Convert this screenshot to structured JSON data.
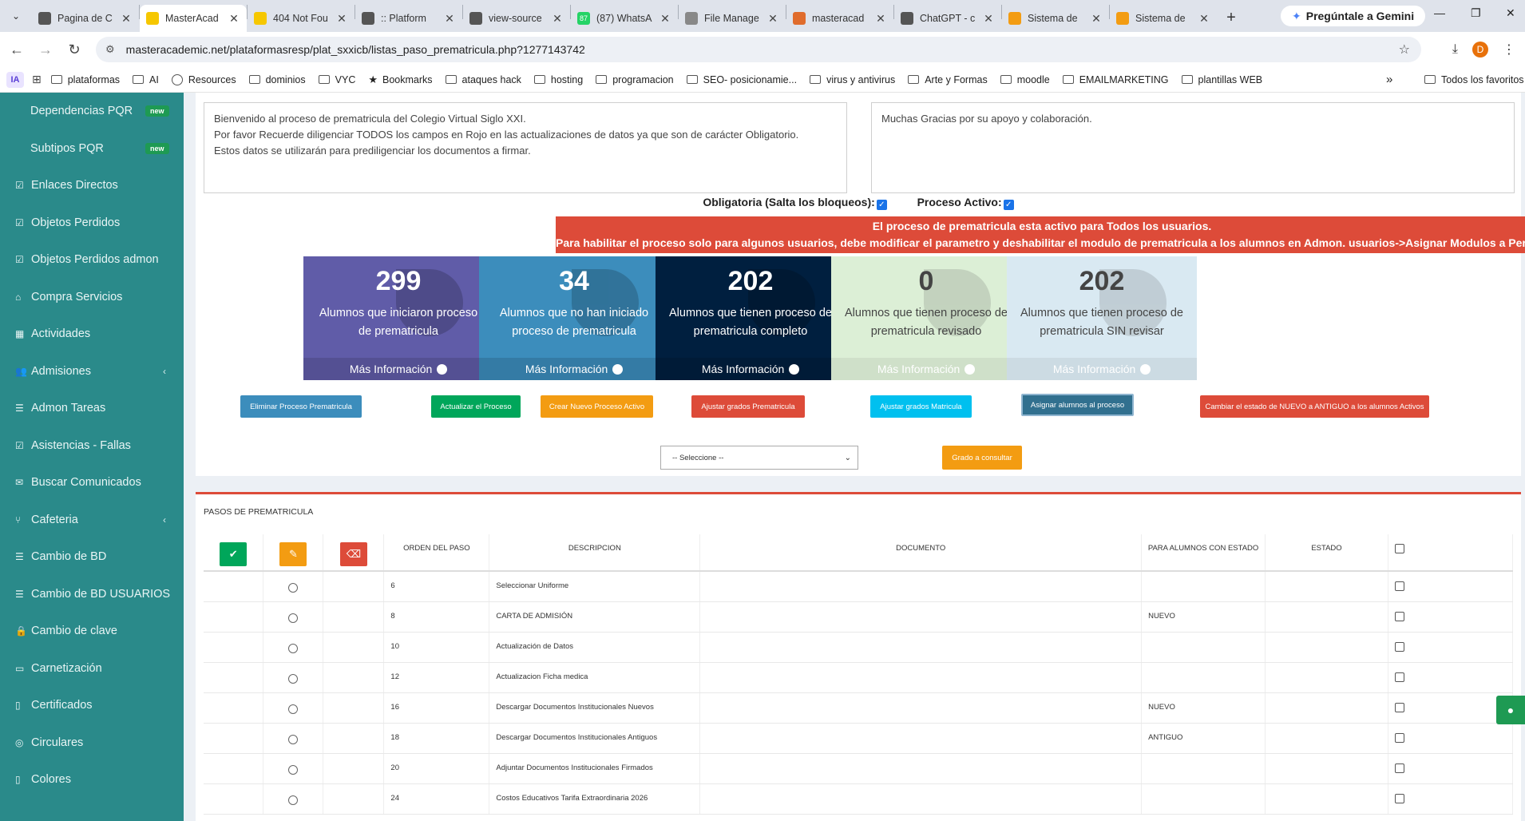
{
  "browser": {
    "tabs": [
      {
        "title": "Pagina de C",
        "favicon_color": "#555555"
      },
      {
        "title": "MasterAcad",
        "favicon_color": "#f6c700",
        "active": true
      },
      {
        "title": "404 Not Fou",
        "favicon_color": "#f6c700"
      },
      {
        "title": ":: Platform",
        "favicon_color": "#555555"
      },
      {
        "title": "view-source",
        "favicon_color": "#555555"
      },
      {
        "title": "(87) WhatsA",
        "favicon_color": "#25d366",
        "badge": "87"
      },
      {
        "title": "File Manage",
        "favicon_color": "#888888"
      },
      {
        "title": "masteracad",
        "favicon_color": "#e06c2c"
      },
      {
        "title": "ChatGPT - c",
        "favicon_color": "#555555"
      },
      {
        "title": "Sistema de",
        "favicon_color": "#f39c12"
      },
      {
        "title": "Sistema de",
        "favicon_color": "#f39c12"
      }
    ],
    "gemini_label": "Pregúntale a Gemini",
    "url": "masteracademic.net/plataformasresp/plat_sxxicb/listas_paso_prematricula.php?1277143742",
    "profile_initial": "D",
    "bookmarks_bar": {
      "ia": "IA",
      "items": [
        {
          "label": "plataformas",
          "icon": "folder-icon"
        },
        {
          "label": "AI",
          "icon": "folder-icon"
        },
        {
          "label": "Resources",
          "icon": "globe-icon"
        },
        {
          "label": "dominios",
          "icon": "folder-icon"
        },
        {
          "label": "VYC",
          "icon": "folder-icon"
        },
        {
          "label": "Bookmarks",
          "icon": "star-icon"
        },
        {
          "label": "ataques hack",
          "icon": "folder-icon"
        },
        {
          "label": "hosting",
          "icon": "folder-icon"
        },
        {
          "label": "programacion",
          "icon": "folder-icon"
        },
        {
          "label": "SEO- posicionamie...",
          "icon": "folder-icon"
        },
        {
          "label": "virus y antivirus",
          "icon": "folder-icon"
        },
        {
          "label": "Arte y Formas",
          "icon": "folder-icon"
        },
        {
          "label": "moodle",
          "icon": "folder-icon"
        },
        {
          "label": "EMAILMARKETING",
          "icon": "folder-icon"
        },
        {
          "label": "plantillas WEB",
          "icon": "folder-icon"
        }
      ],
      "overflow": "»",
      "all_favorites": "Todos los favoritos"
    }
  },
  "sidebar": {
    "items": [
      {
        "label": "Dependencias PQR",
        "icon": "",
        "badge": "new",
        "sub": true
      },
      {
        "label": "Subtipos PQR",
        "icon": "",
        "badge": "new",
        "sub": true
      },
      {
        "label": "Enlaces Directos",
        "icon": "check-square-icon"
      },
      {
        "label": "Objetos Perdidos",
        "icon": "check-square-icon"
      },
      {
        "label": "Objetos Perdidos admon",
        "icon": "check-square-icon"
      },
      {
        "label": "Compra Servicios",
        "icon": "bank-icon"
      },
      {
        "label": "Actividades",
        "icon": "calendar-icon"
      },
      {
        "label": "Admisiones",
        "icon": "users-icon",
        "caret": "‹"
      },
      {
        "label": "Admon Tareas",
        "icon": "list-icon"
      },
      {
        "label": "Asistencias - Fallas",
        "icon": "check-square-icon"
      },
      {
        "label": "Buscar Comunicados",
        "icon": "envelope-icon"
      },
      {
        "label": "Cafeteria",
        "icon": "cutlery-icon",
        "caret": "‹"
      },
      {
        "label": "Cambio de BD",
        "icon": "database-icon"
      },
      {
        "label": "Cambio de BD USUARIOS",
        "icon": "database-icon"
      },
      {
        "label": "Cambio de clave",
        "icon": "lock-icon"
      },
      {
        "label": "Carnetización",
        "icon": "id-card-icon"
      },
      {
        "label": "Certificados",
        "icon": "file-icon"
      },
      {
        "label": "Circulares",
        "icon": "globe-icon"
      },
      {
        "label": "Colores",
        "icon": "file-icon"
      }
    ]
  },
  "main": {
    "welcome_text": "Bienvenido al proceso de prematricula del Colegio Virtual Siglo XXI.\nPor favor Recuerde diligenciar TODOS los campos en Rojo en las actualizaciones de datos ya que son de carácter Obligatorio.\nEstos datos se utilizarán para prediligenciar los documentos a firmar.",
    "thanks_text": "Muchas Gracias por su apoyo y colaboración.",
    "obligatoria_label": "Obligatoria (Salta los bloqueos):",
    "activo_label": "Proceso Activo:",
    "alert_line1": "El proceso de prematricula esta activo para Todos los usuarios.",
    "alert_line2": "Para habilitar el proceso solo para algunos usuarios, debe modificar el parametro y deshabilitar el modulo de prematricula a los alumnos en Admon. usuarios->Asignar Modulos a Perfiles",
    "stats": [
      {
        "value": "299",
        "label": "Alumnos que iniciaron proceso de prematricula",
        "more": "Más Información",
        "bg": "#605ca8",
        "fg": "#ffffff"
      },
      {
        "value": "34",
        "label": "Alumnos que no han iniciado proceso de prematricula",
        "more": "Más Información",
        "bg": "#3c8dbc",
        "fg": "#ffffff"
      },
      {
        "value": "202",
        "label": "Alumnos que tienen proceso de prematricula completo",
        "more": "Más Información",
        "bg": "#001f3f",
        "fg": "#ffffff"
      },
      {
        "value": "0",
        "label": "Alumnos que tienen proceso de prematricula revisado",
        "more": "Más Información",
        "bg": "#dcefd6",
        "fg": "#444444"
      },
      {
        "value": "202",
        "label": "Alumnos que tienen proceso de prematricula SIN revisar",
        "more": "Más Información",
        "bg": "#d9e9f2",
        "fg": "#444444"
      }
    ],
    "buttons": {
      "eliminar": "Eliminar Proceso Prematricula",
      "actualizar": "Actualizar el Proceso",
      "crear": "Crear Nuevo Proceso Activo",
      "ajustar_pre": "Ajustar grados Prematricula",
      "ajustar_mat": "Ajustar grados Matricula",
      "asignar": "Asignar alumnos al proceso",
      "cambiar": "Cambiar el estado de NUEVO a ANTIGUO a los alumnos Activos",
      "grado": "Grado a consultar"
    },
    "select_value": "-- Seleccione --"
  },
  "steps": {
    "title": "PASOS DE PREMATRICULA",
    "headers": {
      "orden": "ORDEN DEL PASO",
      "descripcion": "DESCRIPCION",
      "documento": "DOCUMENTO",
      "para": "PARA ALUMNOS CON ESTADO",
      "estado": "ESTADO"
    },
    "rows": [
      {
        "orden": "6",
        "descripcion": "Seleccionar Uniforme",
        "documento": "",
        "para": "",
        "estado": ""
      },
      {
        "orden": "8",
        "descripcion": "CARTA DE ADMISIÓN",
        "documento": "",
        "para": "NUEVO",
        "estado": ""
      },
      {
        "orden": "10",
        "descripcion": "Actualización de Datos",
        "documento": "",
        "para": "",
        "estado": ""
      },
      {
        "orden": "12",
        "descripcion": "Actualizacion Ficha medica",
        "documento": "",
        "para": "",
        "estado": ""
      },
      {
        "orden": "16",
        "descripcion": "Descargar Documentos Institucionales Nuevos",
        "documento": "",
        "para": "NUEVO",
        "estado": ""
      },
      {
        "orden": "18",
        "descripcion": "Descargar Documentos Institucionales Antiguos",
        "documento": "",
        "para": "ANTIGUO",
        "estado": ""
      },
      {
        "orden": "20",
        "descripcion": "Adjuntar Documentos Institucionales Firmados",
        "documento": "",
        "para": "",
        "estado": ""
      },
      {
        "orden": "24",
        "descripcion": "Costos Educativos Tarifa Extraordinaria 2026",
        "documento": "",
        "para": "",
        "estado": ""
      }
    ]
  }
}
